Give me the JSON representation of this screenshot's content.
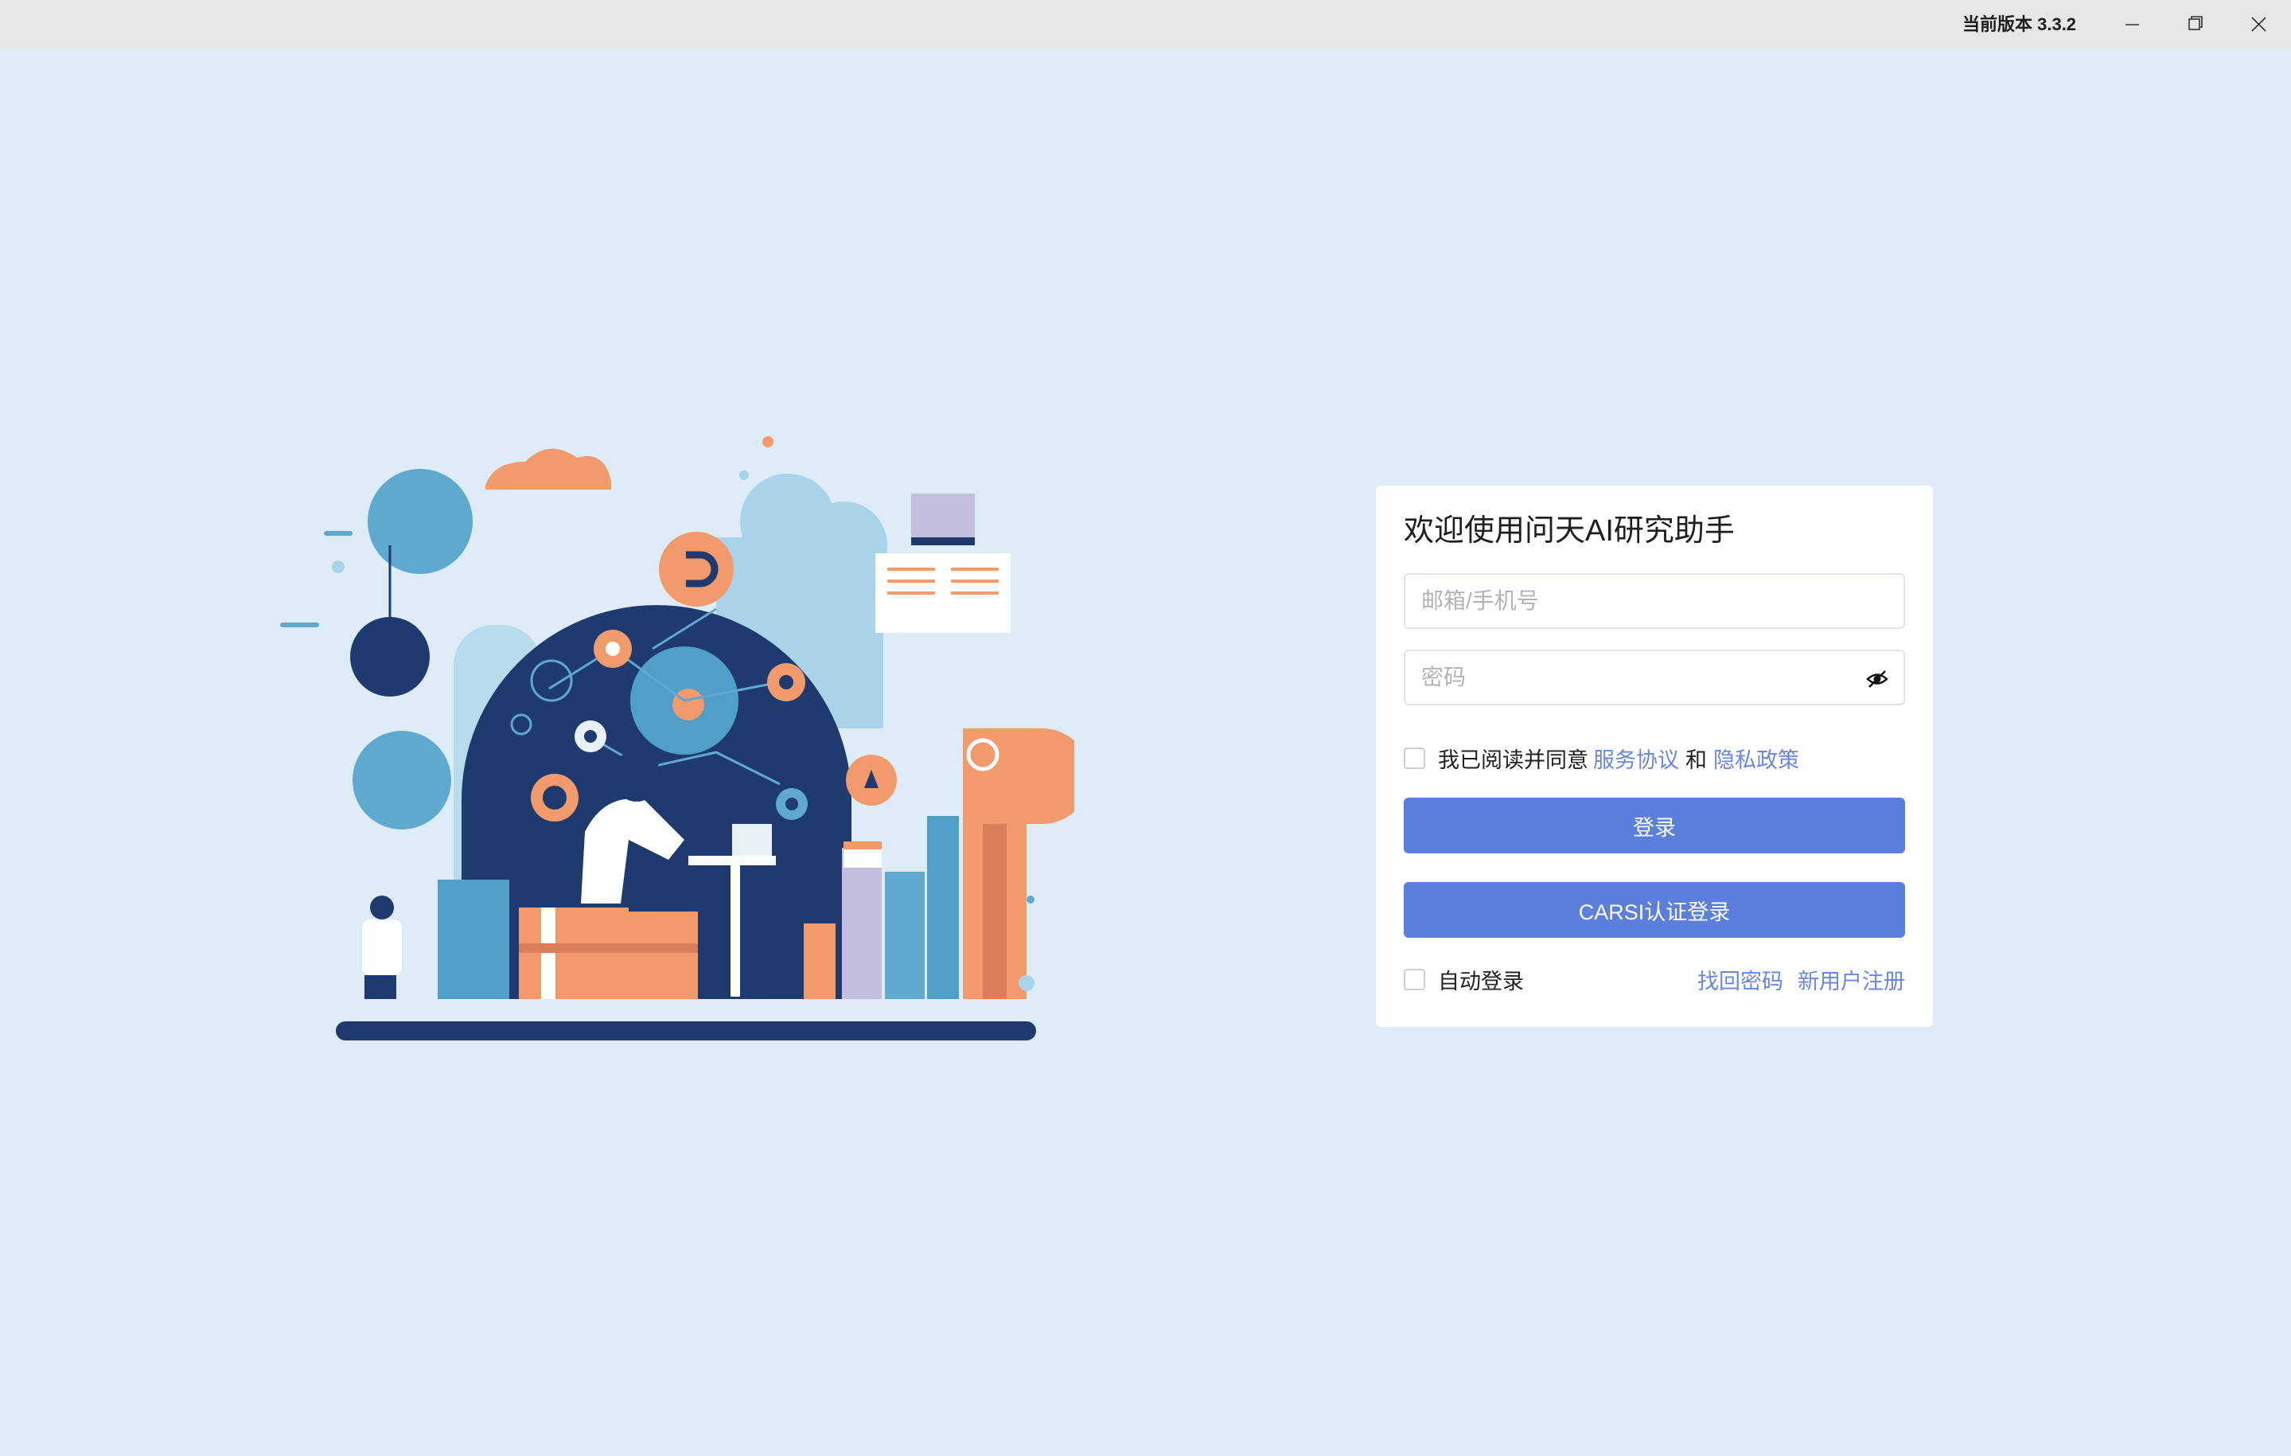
{
  "titlebar": {
    "version_text": "当前版本 3.3.2",
    "buttons": {
      "minimize_icon": "minimize-icon",
      "maximize_icon": "restore-icon",
      "close_icon": "close-icon"
    }
  },
  "login": {
    "title": "欢迎使用问天AI研究助手",
    "account_placeholder": "邮箱/手机号",
    "password_placeholder": "密码",
    "password_toggle_icon": "eye-hidden-icon",
    "agree_text": "我已阅读并同意",
    "service_agreement": "服务协议",
    "and_text": "和",
    "privacy_policy": "隐私政策",
    "login_button": "登录",
    "carsi_button": "CARSI认证登录",
    "auto_login": "自动登录",
    "forgot_password": "找回密码",
    "register": "新用户注册"
  },
  "colors": {
    "background": "#ddecf7",
    "accent": "#5b7fdc",
    "link": "#6a86e0",
    "illustration_navy": "#1f3a6e",
    "illustration_orange": "#f19a6b",
    "illustration_blue": "#5fa9cf"
  }
}
